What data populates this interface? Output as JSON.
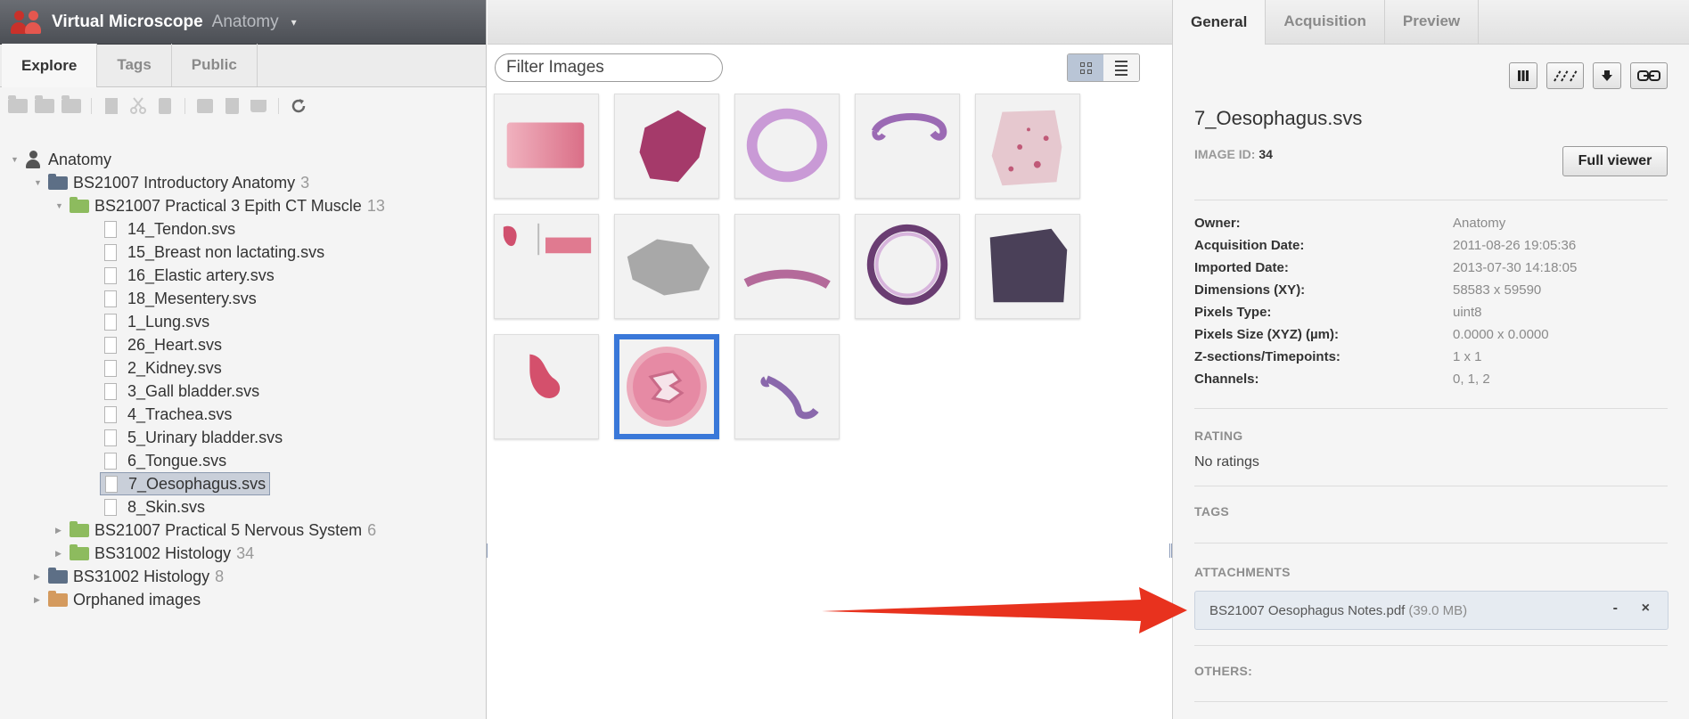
{
  "app": {
    "title": "Virtual Microscope",
    "group": "Anatomy",
    "group_caret": "▾"
  },
  "left_tabs": [
    "Explore",
    "Tags",
    "Public"
  ],
  "tree": {
    "root": "Anatomy",
    "nodes": [
      {
        "label": "BS21007 Introductory Anatomy",
        "count": "3",
        "type": "project"
      },
      {
        "label": "BS21007 Practical 3 Epith CT Muscle",
        "count": "13",
        "type": "dataset"
      },
      {
        "label": "14_Tendon.svs",
        "type": "image"
      },
      {
        "label": "15_Breast non lactating.svs",
        "type": "image"
      },
      {
        "label": "16_Elastic artery.svs",
        "type": "image"
      },
      {
        "label": "18_Mesentery.svs",
        "type": "image"
      },
      {
        "label": "1_Lung.svs",
        "type": "image"
      },
      {
        "label": "26_Heart.svs",
        "type": "image"
      },
      {
        "label": "2_Kidney.svs",
        "type": "image"
      },
      {
        "label": "3_Gall bladder.svs",
        "type": "image"
      },
      {
        "label": "4_Trachea.svs",
        "type": "image"
      },
      {
        "label": "5_Urinary bladder.svs",
        "type": "image"
      },
      {
        "label": "6_Tongue.svs",
        "type": "image"
      },
      {
        "label": "7_Oesophagus.svs",
        "type": "image",
        "selected": true
      },
      {
        "label": "8_Skin.svs",
        "type": "image"
      },
      {
        "label": "BS21007 Practical 5 Nervous System",
        "count": "6",
        "type": "dataset"
      },
      {
        "label": "BS31002 Histology",
        "count": "34",
        "type": "dataset"
      },
      {
        "label": "BS31002 Histology",
        "count": "8",
        "type": "project"
      },
      {
        "label": "Orphaned images",
        "type": "orphan"
      }
    ]
  },
  "center": {
    "filter_placeholder": "Filter Images",
    "selected_thumbnail": 11
  },
  "right_tabs": [
    "General",
    "Acquisition",
    "Preview"
  ],
  "image": {
    "name": "7_Oesophagus.svs",
    "id_label": "IMAGE ID:",
    "id": "34",
    "full_viewer_label": "Full viewer",
    "metadata": [
      {
        "key": "Owner:",
        "value": "Anatomy"
      },
      {
        "key": "Acquisition Date:",
        "value": "2011-08-26 19:05:36"
      },
      {
        "key": "Imported Date:",
        "value": "2013-07-30 14:18:05"
      },
      {
        "key": "Dimensions (XY):",
        "value": "58583 x 59590"
      },
      {
        "key": "Pixels Type:",
        "value": "uint8"
      },
      {
        "key": "Pixels Size (XYZ) (µm):",
        "value": "0.0000 x 0.0000"
      },
      {
        "key": "Z-sections/Timepoints:",
        "value": "1 x 1"
      },
      {
        "key": "Channels:",
        "value": "0, 1, 2"
      }
    ]
  },
  "sections": {
    "rating": "RATING",
    "no_ratings": "No ratings",
    "tags": "TAGS",
    "attachments": "ATTACHMENTS",
    "others": "OTHERS:"
  },
  "attachment": {
    "name": "BS21007 Oesophagus Notes.pdf",
    "size": "(39.0 MB)",
    "minus": "-",
    "close": "×"
  },
  "colors": {
    "selection_blue": "#3a78d9",
    "annotation_arrow": "#e8321e",
    "header_dark": "#4c4f55"
  }
}
